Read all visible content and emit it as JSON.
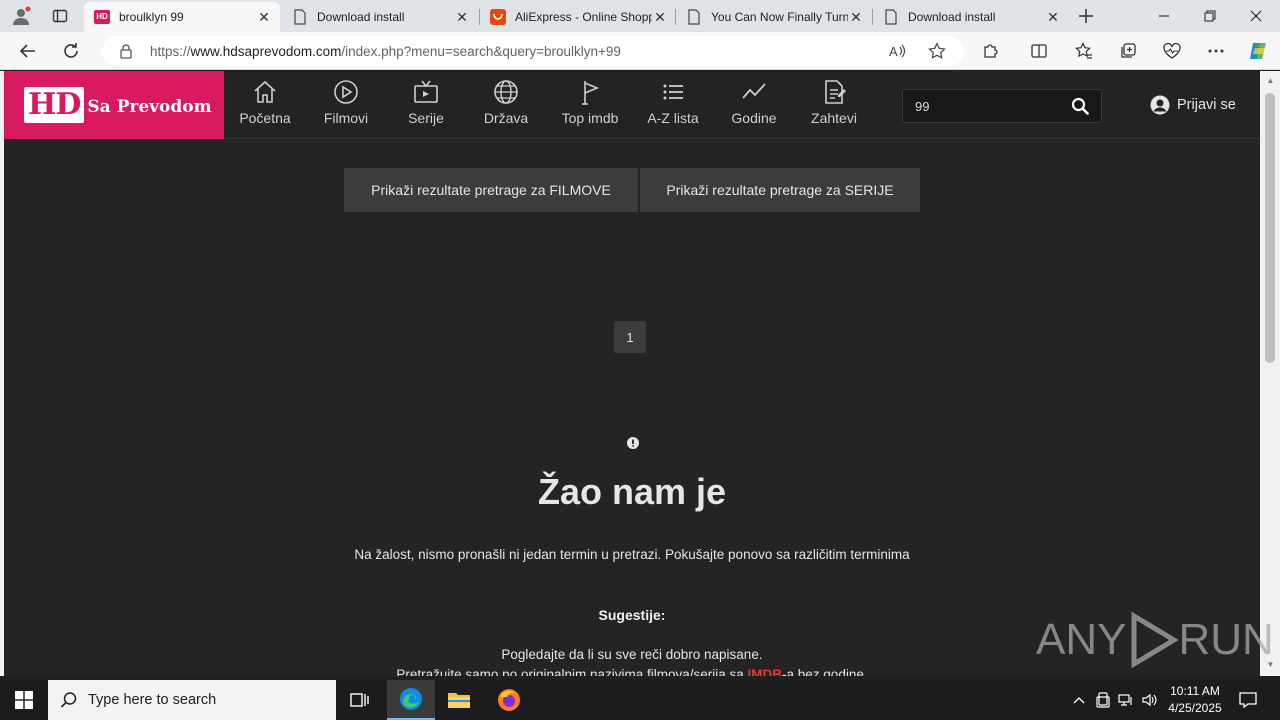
{
  "browser": {
    "tabs": [
      {
        "title": "broulklyn 99",
        "favicon": "hd-site-favicon",
        "active": true
      },
      {
        "title": "Download install",
        "favicon": "page-icon",
        "active": false
      },
      {
        "title": "AliExpress - Online Shopp",
        "favicon": "aliexpress-icon",
        "active": false
      },
      {
        "title": "You Can Now Finally Turn",
        "favicon": "page-icon",
        "active": false
      },
      {
        "title": "Download install",
        "favicon": "page-icon",
        "active": false
      }
    ],
    "favicon_text": "HD",
    "url_prefix": "https://",
    "url_domain": "www.hdsaprevodom.com",
    "url_path": "/index.php?menu=search&query=broulklyn+99"
  },
  "site": {
    "logo_hd": "HD",
    "logo_text": "Sa Prevodom",
    "nav": [
      {
        "label": "Početna",
        "icon": "home-icon"
      },
      {
        "label": "Filmovi",
        "icon": "play-icon"
      },
      {
        "label": "Serije",
        "icon": "tv-icon"
      },
      {
        "label": "Država",
        "icon": "globe-icon"
      },
      {
        "label": "Top imdb",
        "icon": "flag-icon"
      },
      {
        "label": "A-Z lista",
        "icon": "list-icon"
      },
      {
        "label": "Godine",
        "icon": "trend-icon"
      },
      {
        "label": "Zahtevi",
        "icon": "document-icon"
      }
    ],
    "search_value": "99",
    "login_label": "Prijavi se",
    "btn_movies": "Prikaži rezultate pretrage za FILMOVE",
    "btn_series": "Prikaži rezultate pretrage za SERIJE",
    "page_number": "1",
    "sorry_title": "Žao nam je",
    "sorry_text": "Na žalost, nismo pronašli ni jedan termin u pretrazi. Pokušajte ponovo sa različitim terminima",
    "suggestions_title": "Sugestije:",
    "suggestion_1": "Pogledajte da li su sve reči dobro napisane.",
    "suggestion_2_before": "Pretražujte samo po originalnim nazivima filmova/serija sa ",
    "suggestion_2_link": "IMDB",
    "suggestion_2_after": "-a bez godine."
  },
  "watermark": {
    "left": "ANY",
    "right": "RUN"
  },
  "taskbar": {
    "search_placeholder": "Type here to search",
    "time": "10:11 AM",
    "date": "4/25/2025"
  },
  "colors": {
    "brand": "#d81b60",
    "page_bg": "#252323",
    "button_bg": "#3d3b3b",
    "link_red": "#e53935"
  }
}
